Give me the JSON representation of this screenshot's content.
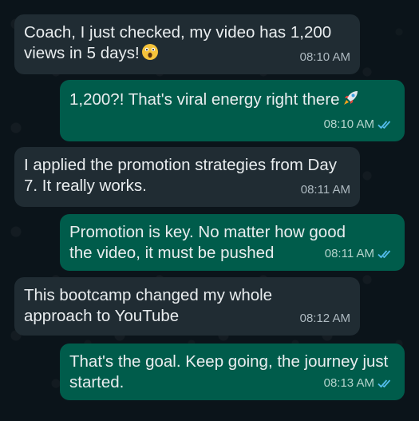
{
  "messages": [
    {
      "direction": "incoming",
      "text": "Coach, I just checked, my video has 1,200 views in 5 days!",
      "emoji": "astonished-face-emoji",
      "time": "08:10 AM"
    },
    {
      "direction": "outgoing",
      "text": "1,200?! That's viral energy right there",
      "emoji": "rocket-emoji",
      "time": "08:10 AM",
      "status": "read"
    },
    {
      "direction": "incoming",
      "text": "I applied the promotion strategies from Day 7. It really works.",
      "time": "08:11 AM"
    },
    {
      "direction": "outgoing",
      "text": "Promotion is key. No matter how good the video, it must be pushed",
      "time": "08:11 AM",
      "status": "read"
    },
    {
      "direction": "incoming",
      "text": "This bootcamp changed my whole approach to YouTube",
      "time": "08:12 AM"
    },
    {
      "direction": "outgoing",
      "text": "That's the goal. Keep going, the journey just started.",
      "time": "08:13 AM",
      "status": "read"
    }
  ],
  "colors": {
    "background": "#0b141a",
    "incoming_bubble": "#202c33",
    "outgoing_bubble": "#005c4b",
    "read_ticks": "#53bdeb"
  }
}
